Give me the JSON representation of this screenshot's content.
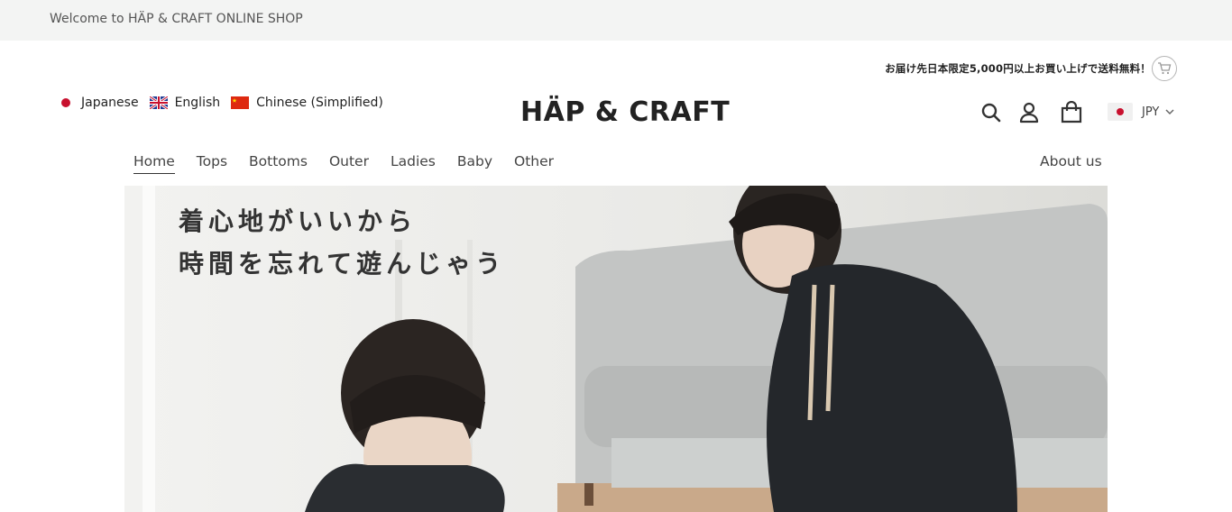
{
  "announcement": "Welcome to HÄP & CRAFT ONLINE SHOP",
  "shipping_notice": "お届け先日本限定5,000円以上お買い上げで送料無料！",
  "languages": [
    {
      "label": "Japanese"
    },
    {
      "label": "English"
    },
    {
      "label": "Chinese (Simplified)"
    }
  ],
  "logo": "HÄP & CRAFT",
  "currency": "JPY",
  "nav": {
    "items": [
      "Home",
      "Tops",
      "Bottoms",
      "Outer",
      "Ladies",
      "Baby",
      "Other"
    ],
    "about": "About us"
  },
  "hero": {
    "line1": "着心地がいいから",
    "line2": "時間を忘れて遊んじゃう"
  },
  "icons": [
    "cart-icon",
    "search-icon",
    "account-icon",
    "bag-icon",
    "chevron-down-icon"
  ],
  "colors": {
    "accent_red": "#c8102e",
    "announcement_bg": "#f3f4f3"
  }
}
